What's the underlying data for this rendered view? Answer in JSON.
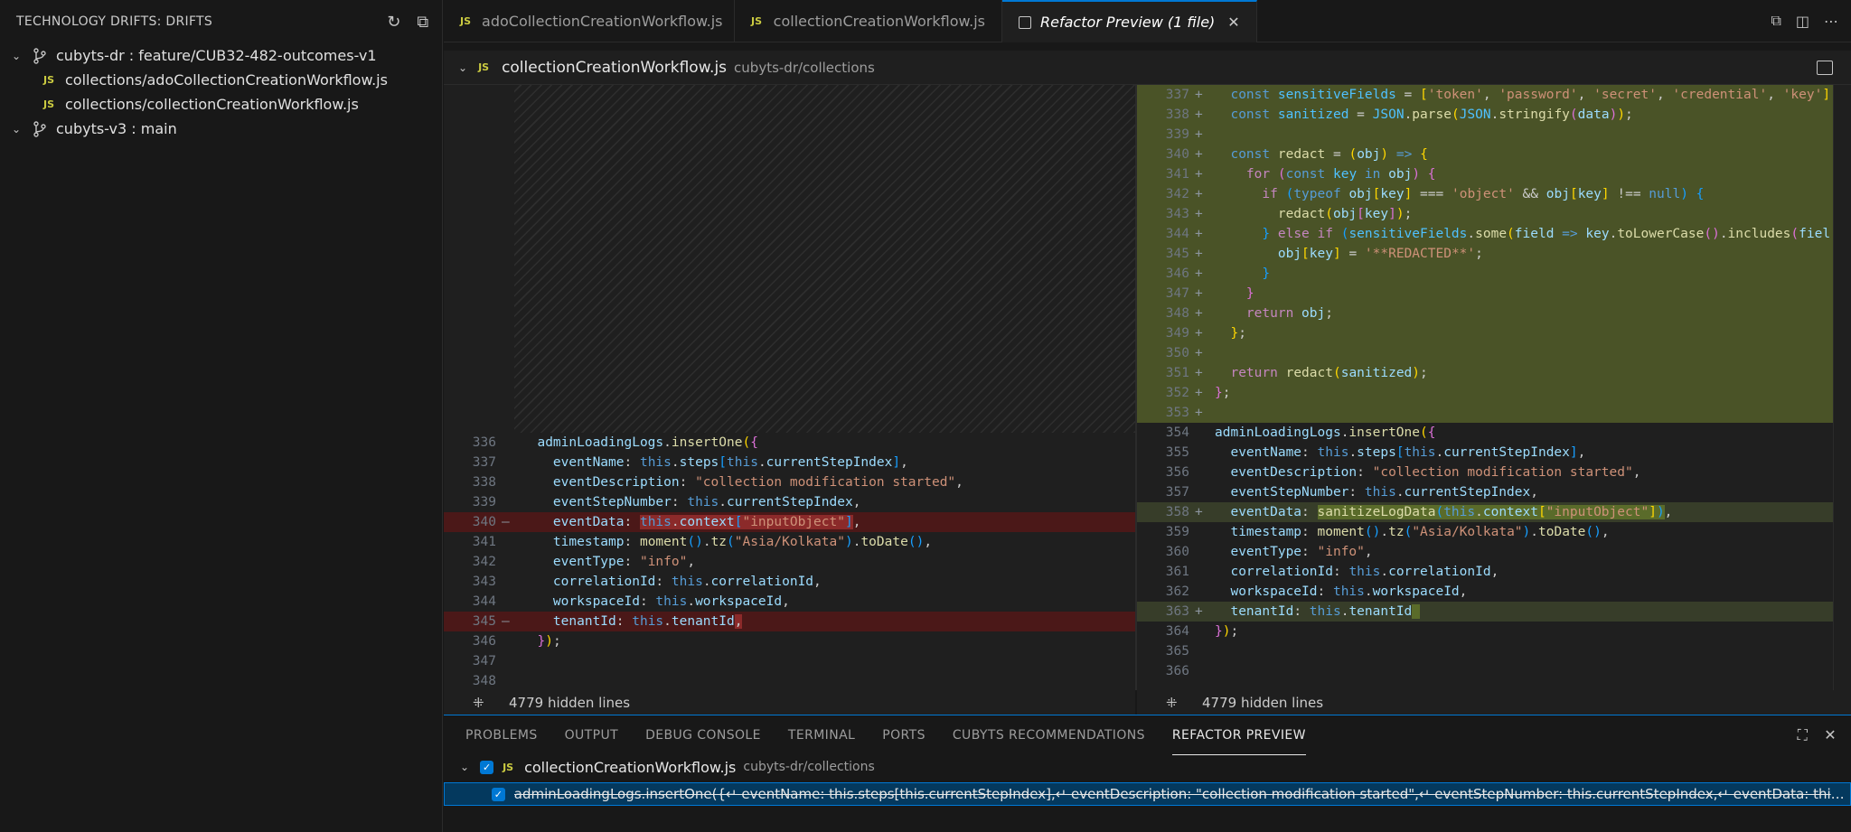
{
  "sidebar": {
    "title": "TECHNOLOGY DRIFTS: DRIFTS",
    "tree": [
      {
        "label": "cubyts-dr : feature/CUB32-482-outcomes-v1"
      },
      {
        "label": "collections/adoCollectionCreationWorkflow.js"
      },
      {
        "label": "collections/collectionCreationWorkflow.js"
      },
      {
        "label": "cubyts-v3 : main"
      }
    ]
  },
  "tabs": [
    {
      "label": "adoCollectionCreationWorkflow.js"
    },
    {
      "label": "collectionCreationWorkflow.js"
    },
    {
      "label": "Refactor Preview (1 file)"
    }
  ],
  "editor": {
    "file": "collectionCreationWorkflow.js",
    "path": "cubyts-dr/collections",
    "hidden_lines": "4779 hidden lines",
    "left_lines": [
      "336",
      "337",
      "338",
      "339",
      "340",
      "341",
      "342",
      "343",
      "344",
      "345",
      "346",
      "347",
      "348"
    ],
    "right_lines": [
      "337",
      "338",
      "339",
      "340",
      "341",
      "342",
      "343",
      "344",
      "345",
      "346",
      "347",
      "348",
      "349",
      "350",
      "351",
      "352",
      "353",
      "354",
      "355",
      "356",
      "357",
      "358",
      "359",
      "360",
      "361",
      "362",
      "363",
      "364",
      "365",
      "366"
    ]
  },
  "panel": {
    "tabs": [
      "PROBLEMS",
      "OUTPUT",
      "DEBUG CONSOLE",
      "TERMINAL",
      "PORTS",
      "CUBYTS RECOMMENDATIONS",
      "REFACTOR PREVIEW"
    ],
    "file": "collectionCreationWorkflow.js",
    "path": "cubyts-dr/collections",
    "change_text": "adminLoadingLogs.insertOne({↵ eventName: this.steps[this.currentStepIndex],↵ eventDescription: \"collection modification started\",↵ eventStepNumber: this.currentStepIndex,↵ eventData: this.co..."
  },
  "colors": {
    "accent": "#0078d4",
    "removed": "#4b1818",
    "added": "#4a5327"
  }
}
